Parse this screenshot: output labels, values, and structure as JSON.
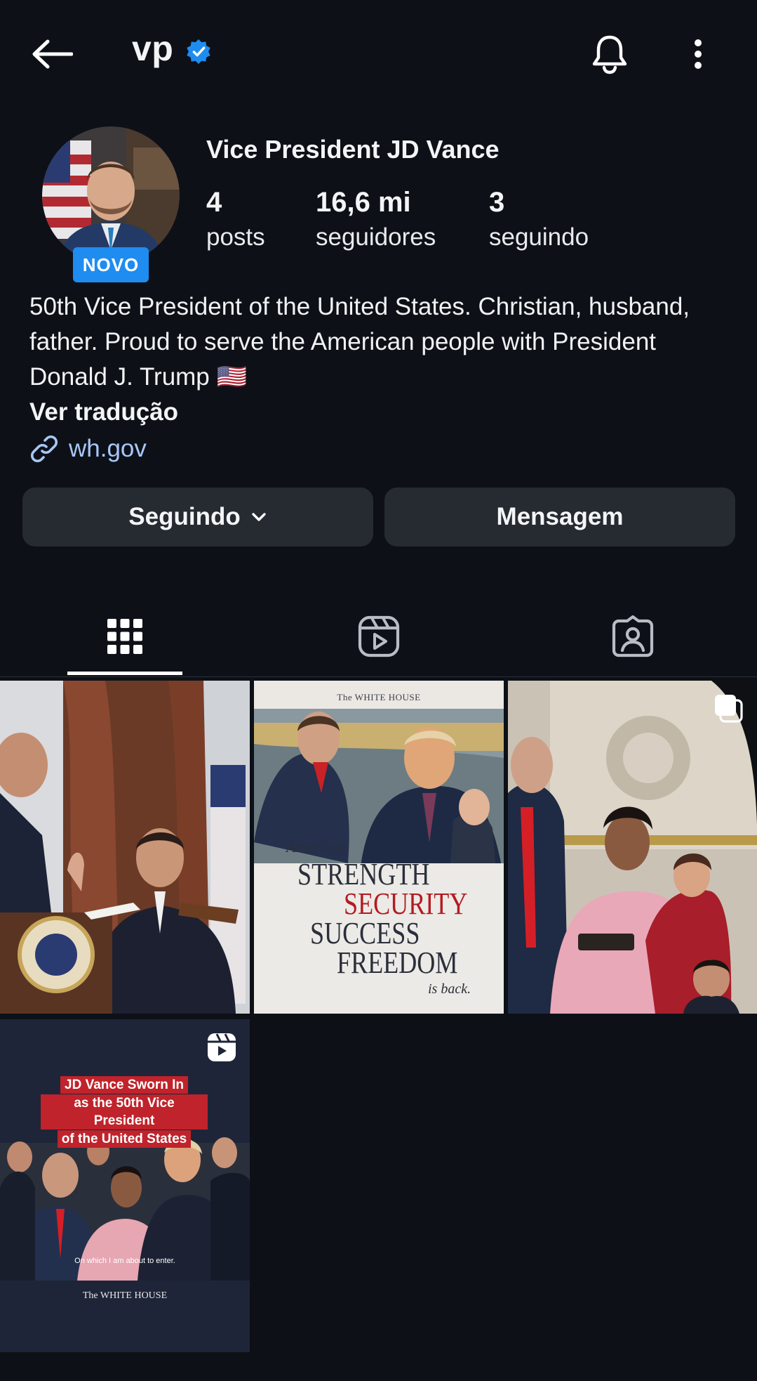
{
  "header": {
    "handle": "vp",
    "verified": true
  },
  "profile": {
    "display_name": "Vice President JD Vance",
    "badge": "NOVO",
    "stats": {
      "posts_count": "4",
      "posts_label": "posts",
      "followers_count": "16,6 mi",
      "followers_label": "seguidores",
      "following_count": "3",
      "following_label": "seguindo"
    },
    "bio_line1": "50th Vice President of the United States. Christian, husband,",
    "bio_line2": "father. Proud to serve the American people with President",
    "bio_line3": "Donald J. Trump 🇺🇸",
    "translate": "Ver tradução",
    "link": "wh.gov"
  },
  "actions": {
    "following_label": "Seguindo",
    "message_label": "Mensagem"
  },
  "tabs": {
    "active": "grid",
    "items": [
      "grid",
      "reels",
      "tagged"
    ]
  },
  "posts": {
    "p2": {
      "header": "The WHITE HOUSE",
      "american": "American",
      "strength": "STRENGTH",
      "security": "SECURITY",
      "success": "SUCCESS",
      "freedom": "FREEDOM",
      "is_back": "is back."
    },
    "p4": {
      "line1": "JD Vance Sworn In",
      "line2": "as the 50th Vice President",
      "line3": "of the United States",
      "caption": "On which I am about to enter.",
      "footer": "The WHITE HOUSE"
    }
  },
  "colors": {
    "background": "#0d1117",
    "button": "#262a31",
    "accent_blue": "#1f8cf0",
    "link": "#a8c7fa"
  }
}
